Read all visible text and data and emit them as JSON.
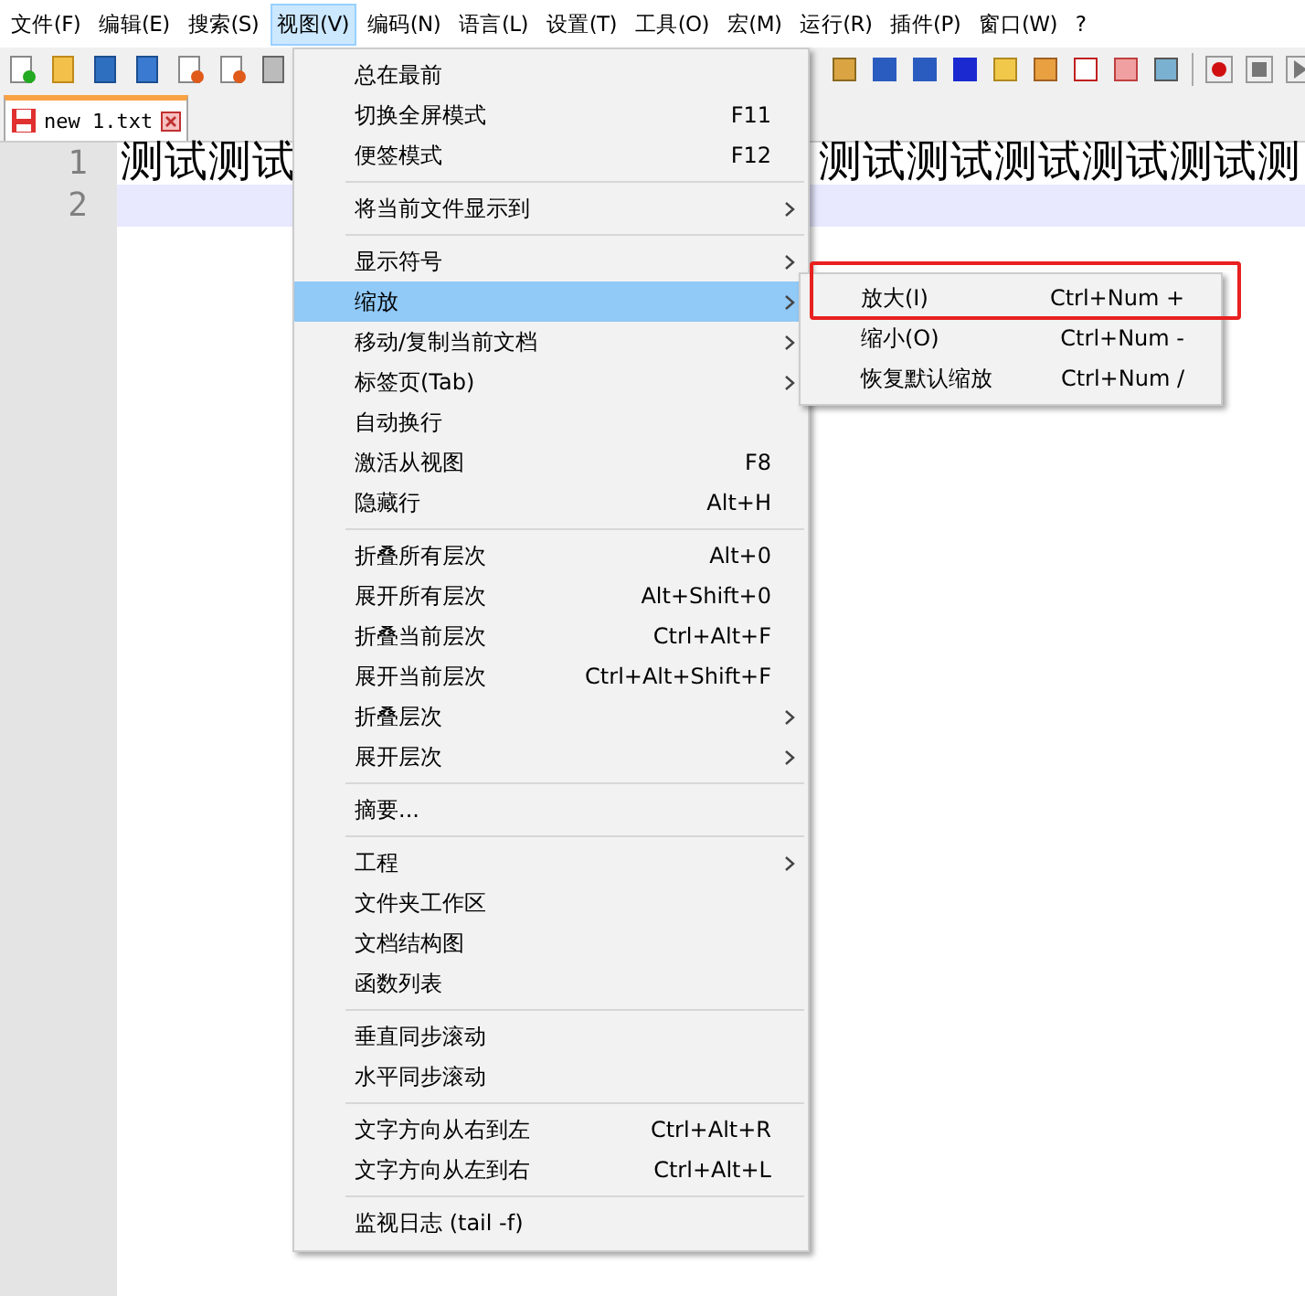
{
  "menu_bar": [
    {
      "label": "文件(F)",
      "selected": false
    },
    {
      "label": "编辑(E)",
      "selected": false
    },
    {
      "label": "搜索(S)",
      "selected": false
    },
    {
      "label": "视图(V)",
      "selected": true
    },
    {
      "label": "编码(N)",
      "selected": false
    },
    {
      "label": "语言(L)",
      "selected": false
    },
    {
      "label": "设置(T)",
      "selected": false
    },
    {
      "label": "工具(O)",
      "selected": false
    },
    {
      "label": "宏(M)",
      "selected": false
    },
    {
      "label": "运行(R)",
      "selected": false
    },
    {
      "label": "插件(P)",
      "selected": false
    },
    {
      "label": "窗口(W)",
      "selected": false
    },
    {
      "label": "?",
      "selected": false
    }
  ],
  "tabs": [
    {
      "label": "new 1.txt",
      "selected": true
    }
  ],
  "editor": {
    "lines": [
      {
        "number": "1",
        "segments": [
          "测试测试",
          "测试测试测试测试测试测"
        ],
        "current": false
      },
      {
        "number": "2",
        "current": true
      }
    ]
  },
  "view_menu": {
    "items": [
      {
        "kind": "item",
        "label": "总在最前",
        "selected": false,
        "submenu": false
      },
      {
        "kind": "item",
        "label": "切换全屏模式",
        "shortcut": "F11",
        "selected": false,
        "submenu": false
      },
      {
        "kind": "item",
        "label": "便签模式",
        "shortcut": "F12",
        "selected": false,
        "submenu": false
      },
      {
        "kind": "separator"
      },
      {
        "kind": "item",
        "label": "将当前文件显示到",
        "selected": false,
        "submenu": true
      },
      {
        "kind": "separator"
      },
      {
        "kind": "item",
        "label": "显示符号",
        "selected": false,
        "submenu": true
      },
      {
        "kind": "item",
        "label": "缩放",
        "selected": true,
        "submenu": true
      },
      {
        "kind": "item",
        "label": "移动/复制当前文档",
        "selected": false,
        "submenu": true
      },
      {
        "kind": "item",
        "label": "标签页(Tab)",
        "selected": false,
        "submenu": true
      },
      {
        "kind": "item",
        "label": "自动换行",
        "selected": false,
        "submenu": false
      },
      {
        "kind": "item",
        "label": "激活从视图",
        "shortcut": "F8",
        "selected": false,
        "submenu": false
      },
      {
        "kind": "item",
        "label": "隐藏行",
        "shortcut": "Alt+H",
        "selected": false,
        "submenu": false
      },
      {
        "kind": "separator"
      },
      {
        "kind": "item",
        "label": "折叠所有层次",
        "shortcut": "Alt+0",
        "selected": false,
        "submenu": false
      },
      {
        "kind": "item",
        "label": "展开所有层次",
        "shortcut": "Alt+Shift+0",
        "selected": false,
        "submenu": false
      },
      {
        "kind": "item",
        "label": "折叠当前层次",
        "shortcut": "Ctrl+Alt+F",
        "selected": false,
        "submenu": false
      },
      {
        "kind": "item",
        "label": "展开当前层次",
        "shortcut": "Ctrl+Alt+Shift+F",
        "selected": false,
        "submenu": false
      },
      {
        "kind": "item",
        "label": "折叠层次",
        "selected": false,
        "submenu": true
      },
      {
        "kind": "item",
        "label": "展开层次",
        "selected": false,
        "submenu": true
      },
      {
        "kind": "separator"
      },
      {
        "kind": "item",
        "label": "摘要...",
        "selected": false,
        "submenu": false
      },
      {
        "kind": "separator"
      },
      {
        "kind": "item",
        "label": "工程",
        "selected": false,
        "submenu": true
      },
      {
        "kind": "item",
        "label": "文件夹工作区",
        "selected": false,
        "submenu": false
      },
      {
        "kind": "item",
        "label": "文档结构图",
        "selected": false,
        "submenu": false
      },
      {
        "kind": "item",
        "label": "函数列表",
        "selected": false,
        "submenu": false
      },
      {
        "kind": "separator"
      },
      {
        "kind": "item",
        "label": "垂直同步滚动",
        "selected": false,
        "submenu": false
      },
      {
        "kind": "item",
        "label": "水平同步滚动",
        "selected": false,
        "submenu": false
      },
      {
        "kind": "separator"
      },
      {
        "kind": "item",
        "label": "文字方向从右到左",
        "shortcut": "Ctrl+Alt+R",
        "selected": false,
        "submenu": false
      },
      {
        "kind": "item",
        "label": "文字方向从左到右",
        "shortcut": "Ctrl+Alt+L",
        "selected": false,
        "submenu": false
      },
      {
        "kind": "separator"
      },
      {
        "kind": "item",
        "label": "监视日志 (tail -f)",
        "selected": false,
        "submenu": false
      }
    ]
  },
  "zoom_submenu": {
    "items": [
      {
        "label": "放大(I)",
        "shortcut": "Ctrl+Num +",
        "annotated": true
      },
      {
        "label": "缩小(O)",
        "shortcut": "Ctrl+Num -",
        "annotated": false
      },
      {
        "label": "恢复默认缩放",
        "shortcut": "Ctrl+Num /",
        "annotated": false
      }
    ]
  }
}
